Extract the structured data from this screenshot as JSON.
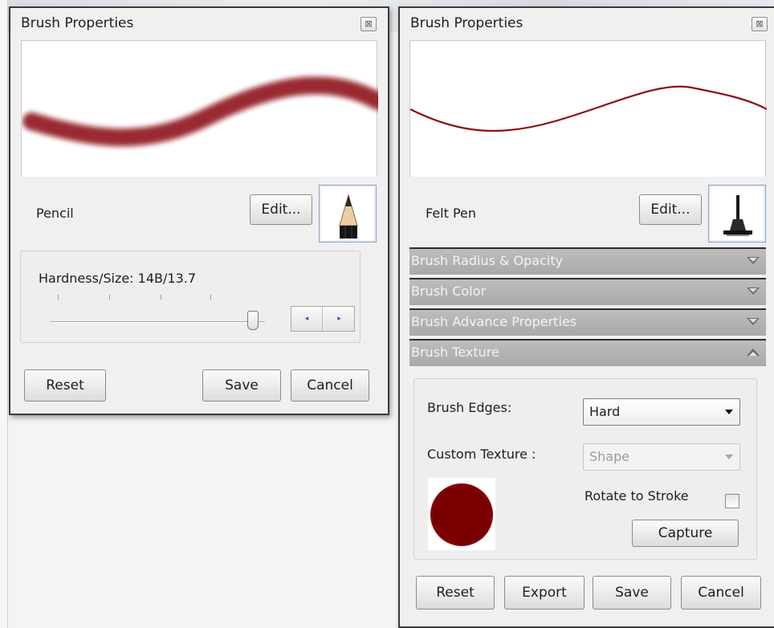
{
  "left_window": {
    "title": "Brush Properties",
    "close_glyph": "⊠",
    "brush_name": "Pencil",
    "edit_label": "Edit...",
    "brush_icon": "pencil-icon",
    "hardness_size_label": "Hardness/Size: 14B/13.7",
    "slider_fraction": 0.95,
    "stepper_left_glyph": "◂",
    "stepper_right_glyph": "▸",
    "reset_label": "Reset",
    "save_label": "Save",
    "cancel_label": "Cancel"
  },
  "right_window": {
    "title": "Brush Properties",
    "close_glyph": "⊠",
    "brush_name": "Felt Pen",
    "edit_label": "Edit...",
    "brush_icon": "felt-pen-icon",
    "sections": [
      {
        "label": "Brush Radius & Opacity",
        "expanded": false
      },
      {
        "label": "Brush Color",
        "expanded": false
      },
      {
        "label": "Brush Advance Properties",
        "expanded": false
      },
      {
        "label": "Brush Texture",
        "expanded": true
      }
    ],
    "texture": {
      "edges_label": "Brush Edges:",
      "edges_value": "Hard",
      "custom_texture_label": "Custom Texture :",
      "custom_texture_value": "Shape",
      "rotate_label": "Rotate to Stroke",
      "rotate_checked": false,
      "capture_label": "Capture"
    },
    "reset_label": "Reset",
    "export_label": "Export",
    "save_label": "Save",
    "cancel_label": "Cancel"
  },
  "colors": {
    "stroke_color": "#8b0d12",
    "swatch_color": "#7a0000"
  }
}
